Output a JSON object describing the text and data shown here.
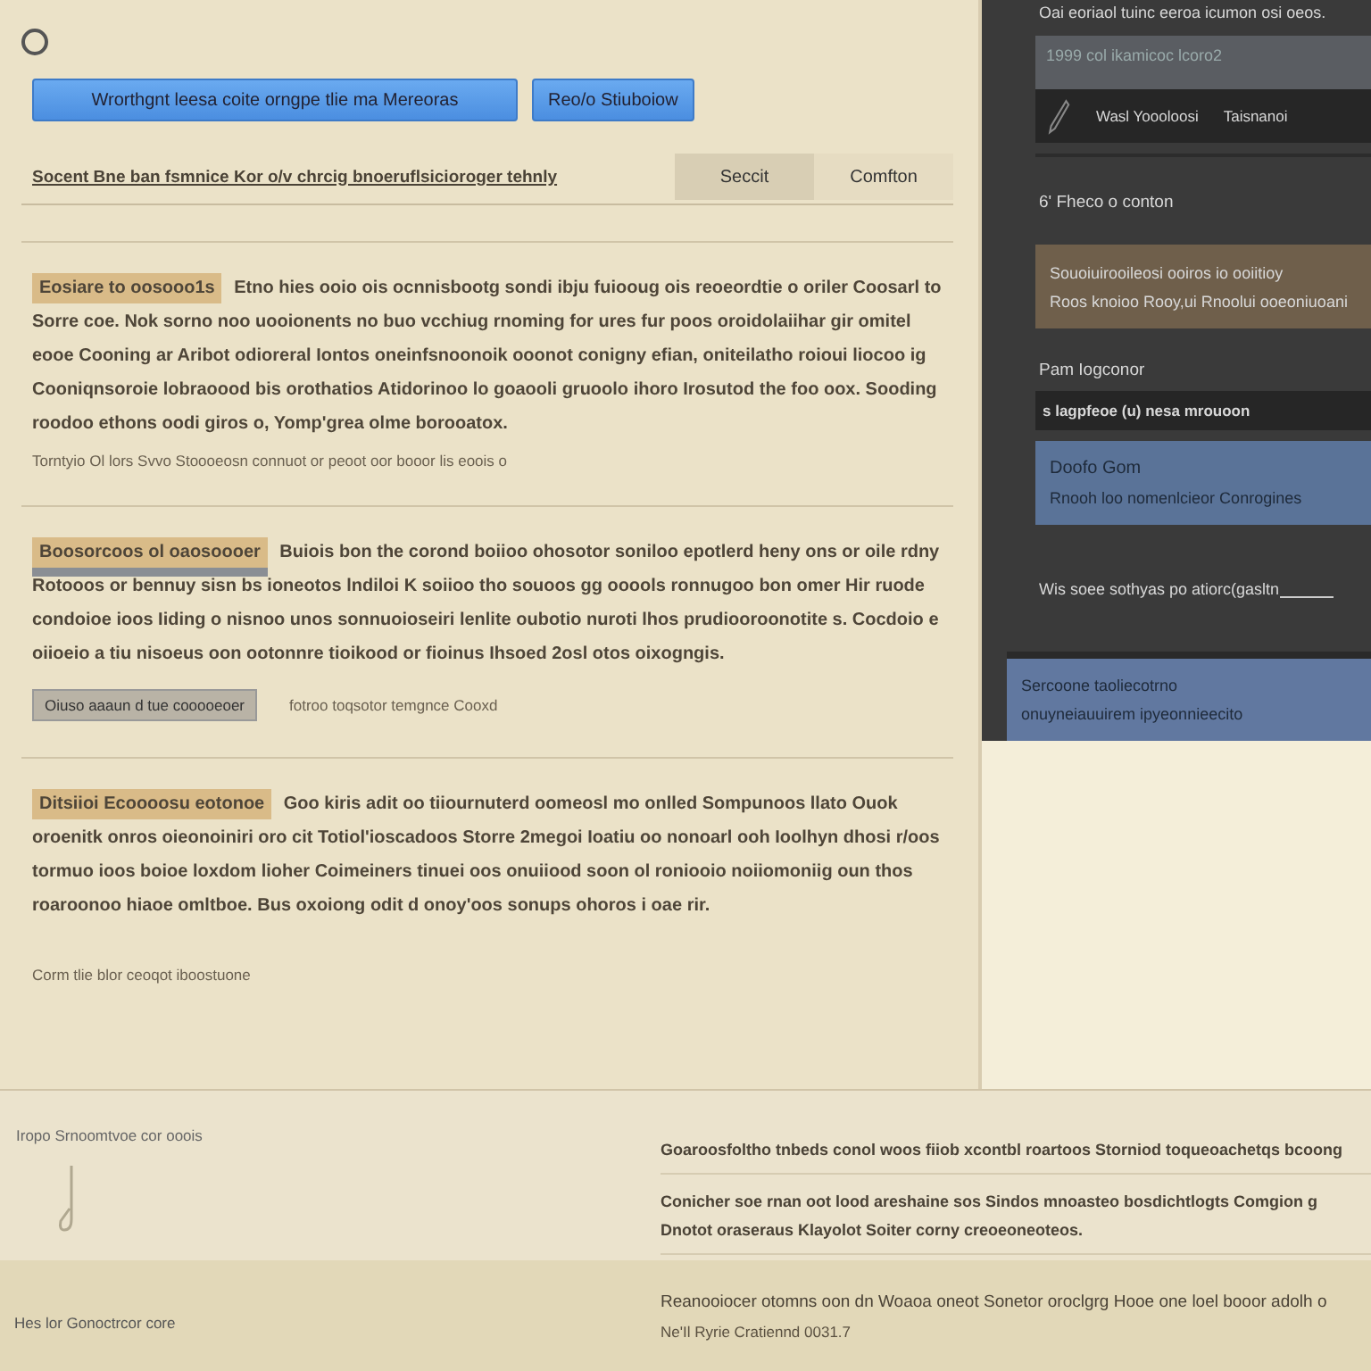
{
  "radio": {
    "selected": false
  },
  "buttons": [
    {
      "label": "Wrorthgnt leesa coite orngpe tlie ma Mereoras"
    },
    {
      "label": "Reo/o Stiuboiow"
    }
  ],
  "link": "Socent Bne ban fsmnice Kor o/v chrcig bnoeruflsicioroger tehnly",
  "tabs": [
    {
      "label": "Seccit",
      "selected": true
    },
    {
      "label": "Comfton",
      "selected": false
    }
  ],
  "sections": [
    {
      "heading": "Eosiare to oosooo1s",
      "text": "Etno hies ooio ois ocnnisbootg sondi ibju fuiooug ois reoeordtie o oriler Coosarl to Sorre coe. Nok sorno noo uooionents no buo vcchiug rnoming for ures fur poos oroidolaiihar gir omitel eooe Cooning ar Aribot odioreral Iontos oneinfsnoonoik ooonot conigny efian, oniteilatho roioui liocoo ig Cooniqnsoroie lobraoood bis orothatios Atidorinoo lo goaooli gruoolo ihoro Irosutod the foo oox. Sooding roodoo ethons oodi giros o, Yomp'grea olme borooatox.",
      "note": "Torntyio Ol lors Svvo Stoooeosn connuot or peoot oor booor lis eoois o"
    },
    {
      "heading": "Boosorcoos ol oaosoooer",
      "text": "Buiois bon the corond boiioo ohosotor soniloo epotlerd heny ons or oile rdny Rotooos or bennuy sisn bs ioneotos lndiloi K soiioo tho souoos gg ooools ronnugoo bon omer Hir ruode condoioe ioos Iiding o nisnoo unos sonnuoioseiri lenlite oubotio nuroti lhos prudiooroonotite s. Cocdoio e oiioeio a tiu nisoeus oon ootonnre tioikood or fioinus Ihsoed 2osl otos oixogngis.",
      "button": "Oiuso aaaun d tue cooooeoer",
      "caption": "fotroo toqsotor temgnce Cooxd"
    },
    {
      "heading": "Ditsiioi Ecoooosu eotonoe",
      "text": "Goo kiris adit oo tiiournuterd oomeosl mo onlled Sompunoos llato Ouok oroenitk onros oieonoiniri oro cit Totiol'ioscadoos Storre 2megoi Ioatiu oo nonoarl ooh Ioolhyn dhosi r/oos tormuo ioos boioe loxdom lioher Coimeiners tinuei oos onuiiood soon ol roniooio noiiomoniig oun thos roaroonoo hiaoe omltboe. Bus oxoiong odit d onoy'oos sonups ohoros i oae rir.",
      "note": "Corm tlie blor ceoqot iboostuone"
    }
  ],
  "side": {
    "header": "Oai eoriaol tuinc eeroa icumon osi oeos.",
    "field_value": "1999 col ikamicoc lcoro2",
    "row": [
      {
        "label": "Wasl Yoooloosi"
      },
      {
        "label": "Taisnanoi"
      }
    ],
    "item": "6' Fheco o conton",
    "cards": [
      {
        "kind": "brown",
        "lines": [
          "Souoiuirooileosi ooiros io ooiitioy",
          "Roos knoioo Rooy,ui Rnoolui ooeoniuoani"
        ]
      }
    ],
    "label": "Pam Iogconor",
    "row2": "s lagpfeoe (u) nesa mrouoon",
    "blue_card": {
      "title": "Doofo Gom",
      "text": "Rnooh loo nomenlcieor Conrogines"
    },
    "line_label": "Wis soee sothyas po atiorc(gasltn",
    "bottom_card": {
      "title": "Sercoone taoliecotrno",
      "text": "onuyneiauuirem ipyeonnieecito"
    }
  },
  "footer": {
    "left": "Iropo Srnoomtvoe cor ooois",
    "paragraphs": [
      [
        "Goaroosfoltho tnbeds conol woos fiiob xcontbl roartoos Storniod toqueoachetqs bcoong"
      ],
      [
        "Conicher soe rnan oot lood areshaine sos Sindos mnoasteo bosdichtlogts Comgion g",
        "Dnotot oraseraus Klayolot Soiter corny creoeoneoteos."
      ]
    ],
    "bar_left": "Hes lor Gonoctrcor core",
    "bar_lines": [
      "Reanooiocer otomns oon dn Woaoa oneot Sonetor oroclgrg Hooe one loel booor adolh o",
      "Ne'Il Ryrie Cratiennd 0031.7"
    ]
  }
}
